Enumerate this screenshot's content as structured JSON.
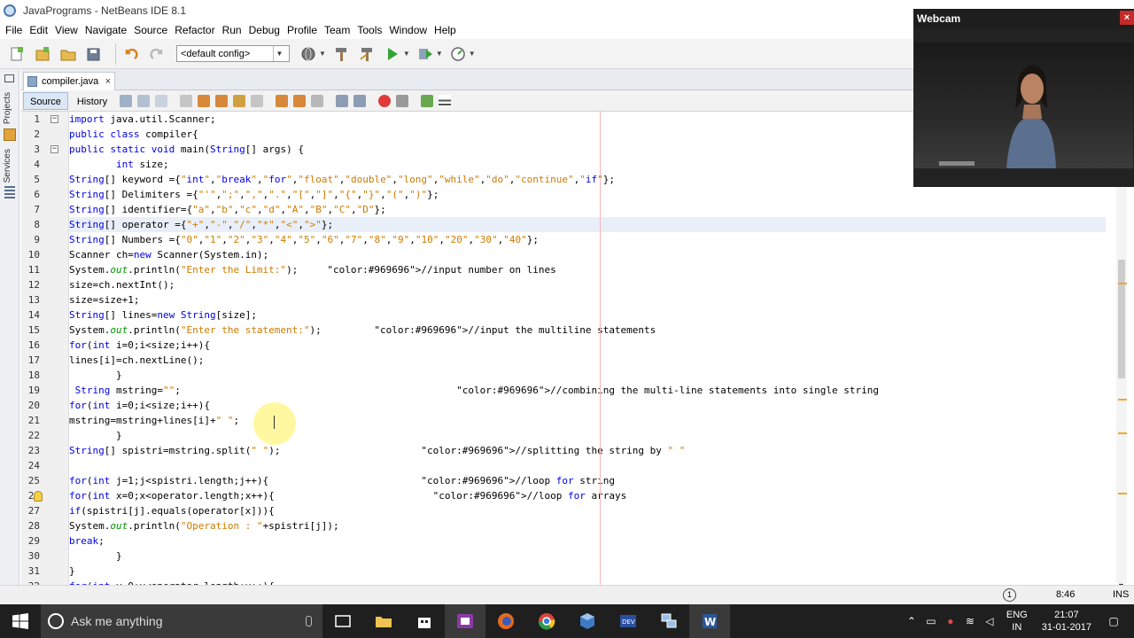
{
  "window": {
    "title": "JavaPrograms - NetBeans IDE 8.1"
  },
  "menu": [
    "File",
    "Edit",
    "View",
    "Navigate",
    "Source",
    "Refactor",
    "Run",
    "Debug",
    "Profile",
    "Team",
    "Tools",
    "Window",
    "Help"
  ],
  "toolbar": {
    "config": "<default config>"
  },
  "side_tabs": {
    "projects": "Projects",
    "services": "Services"
  },
  "file_tab": {
    "name": "compiler.java",
    "close": "×"
  },
  "editor_tabs": {
    "source": "Source",
    "history": "History"
  },
  "code": [
    {
      "n": "1",
      "fold": "−",
      "text": "import java.util.Scanner;"
    },
    {
      "n": "2",
      "text": "public class compiler{"
    },
    {
      "n": "3",
      "fold": "−",
      "text": "public static void main(String[] args) {"
    },
    {
      "n": "4",
      "text": "        int size;"
    },
    {
      "n": "5",
      "text": "String[] keyword ={\"int\",\"break\",\"for\",\"float\",\"double\",\"long\",\"while\",\"do\",\"continue\",\"if\"};"
    },
    {
      "n": "6",
      "text": "String[] Delimiters ={\"'\",\";\",\",\",\".\",\"[\",\"]\",\"{\",\"}\",\"(\",\")\"};"
    },
    {
      "n": "7",
      "text": "String[] identifier={\"a\",\"b\",\"c\",\"d\",\"A\",\"B\",\"C\",\"D\"};"
    },
    {
      "n": "8",
      "text": "String[] operator ={\"+\",\"-\",\"/\",\"*\",\"<\",\">\"};",
      "hl": true
    },
    {
      "n": "9",
      "text": "String[] Numbers ={\"0\",\"1\",\"2\",\"3\",\"4\",\"5\",\"6\",\"7\",\"8\",\"9\",\"10\",\"20\",\"30\",\"40\"};"
    },
    {
      "n": "10",
      "text": "Scanner ch=new Scanner(System.in);"
    },
    {
      "n": "11",
      "text": "System.out.println(\"Enter the Limit:\");     //input number on lines"
    },
    {
      "n": "12",
      "text": "size=ch.nextInt();"
    },
    {
      "n": "13",
      "text": "size=size+1;"
    },
    {
      "n": "14",
      "text": "String[] lines=new String[size];"
    },
    {
      "n": "15",
      "text": "System.out.println(\"Enter the statement:\");         //input the multiline statements"
    },
    {
      "n": "16",
      "text": "for(int i=0;i<size;i++){"
    },
    {
      "n": "17",
      "text": "lines[i]=ch.nextLine();"
    },
    {
      "n": "18",
      "text": "        }"
    },
    {
      "n": "19",
      "text": " String mstring=\"\";                                               //combining the multi-line statements into single string"
    },
    {
      "n": "20",
      "text": "for(int i=0;i<size;i++){"
    },
    {
      "n": "21",
      "text": "mstring=mstring+lines[i]+\" \";"
    },
    {
      "n": "22",
      "text": "        }"
    },
    {
      "n": "23",
      "text": "String[] spistri=mstring.split(\" \");                        //splitting the string by \" \""
    },
    {
      "n": "24",
      "text": ""
    },
    {
      "n": "25",
      "text": "for(int j=1;j<spistri.length;j++){                          //loop for string"
    },
    {
      "n": "26",
      "text": "for(int x=0;x<operator.length;x++){                           //loop for arrays"
    },
    {
      "n": "27",
      "text": "if(spistri[j].equals(operator[x])){"
    },
    {
      "n": "28",
      "text": "System.out.println(\"Operation : \"+spistri[j]);"
    },
    {
      "n": "29",
      "text": "break;"
    },
    {
      "n": "30",
      "text": "        }"
    },
    {
      "n": "31",
      "text": "}"
    },
    {
      "n": "32",
      "text": "for(int y=0;y<operator.length;y++){"
    }
  ],
  "statusbar": {
    "position": "8:46",
    "mode": "INS"
  },
  "webcam": {
    "title": "Webcam",
    "close": "×"
  },
  "taskbar": {
    "search_placeholder": "Ask me anything",
    "lang_top": "ENG",
    "lang_bottom": "IN",
    "time": "21:07",
    "date": "31-01-2017"
  }
}
